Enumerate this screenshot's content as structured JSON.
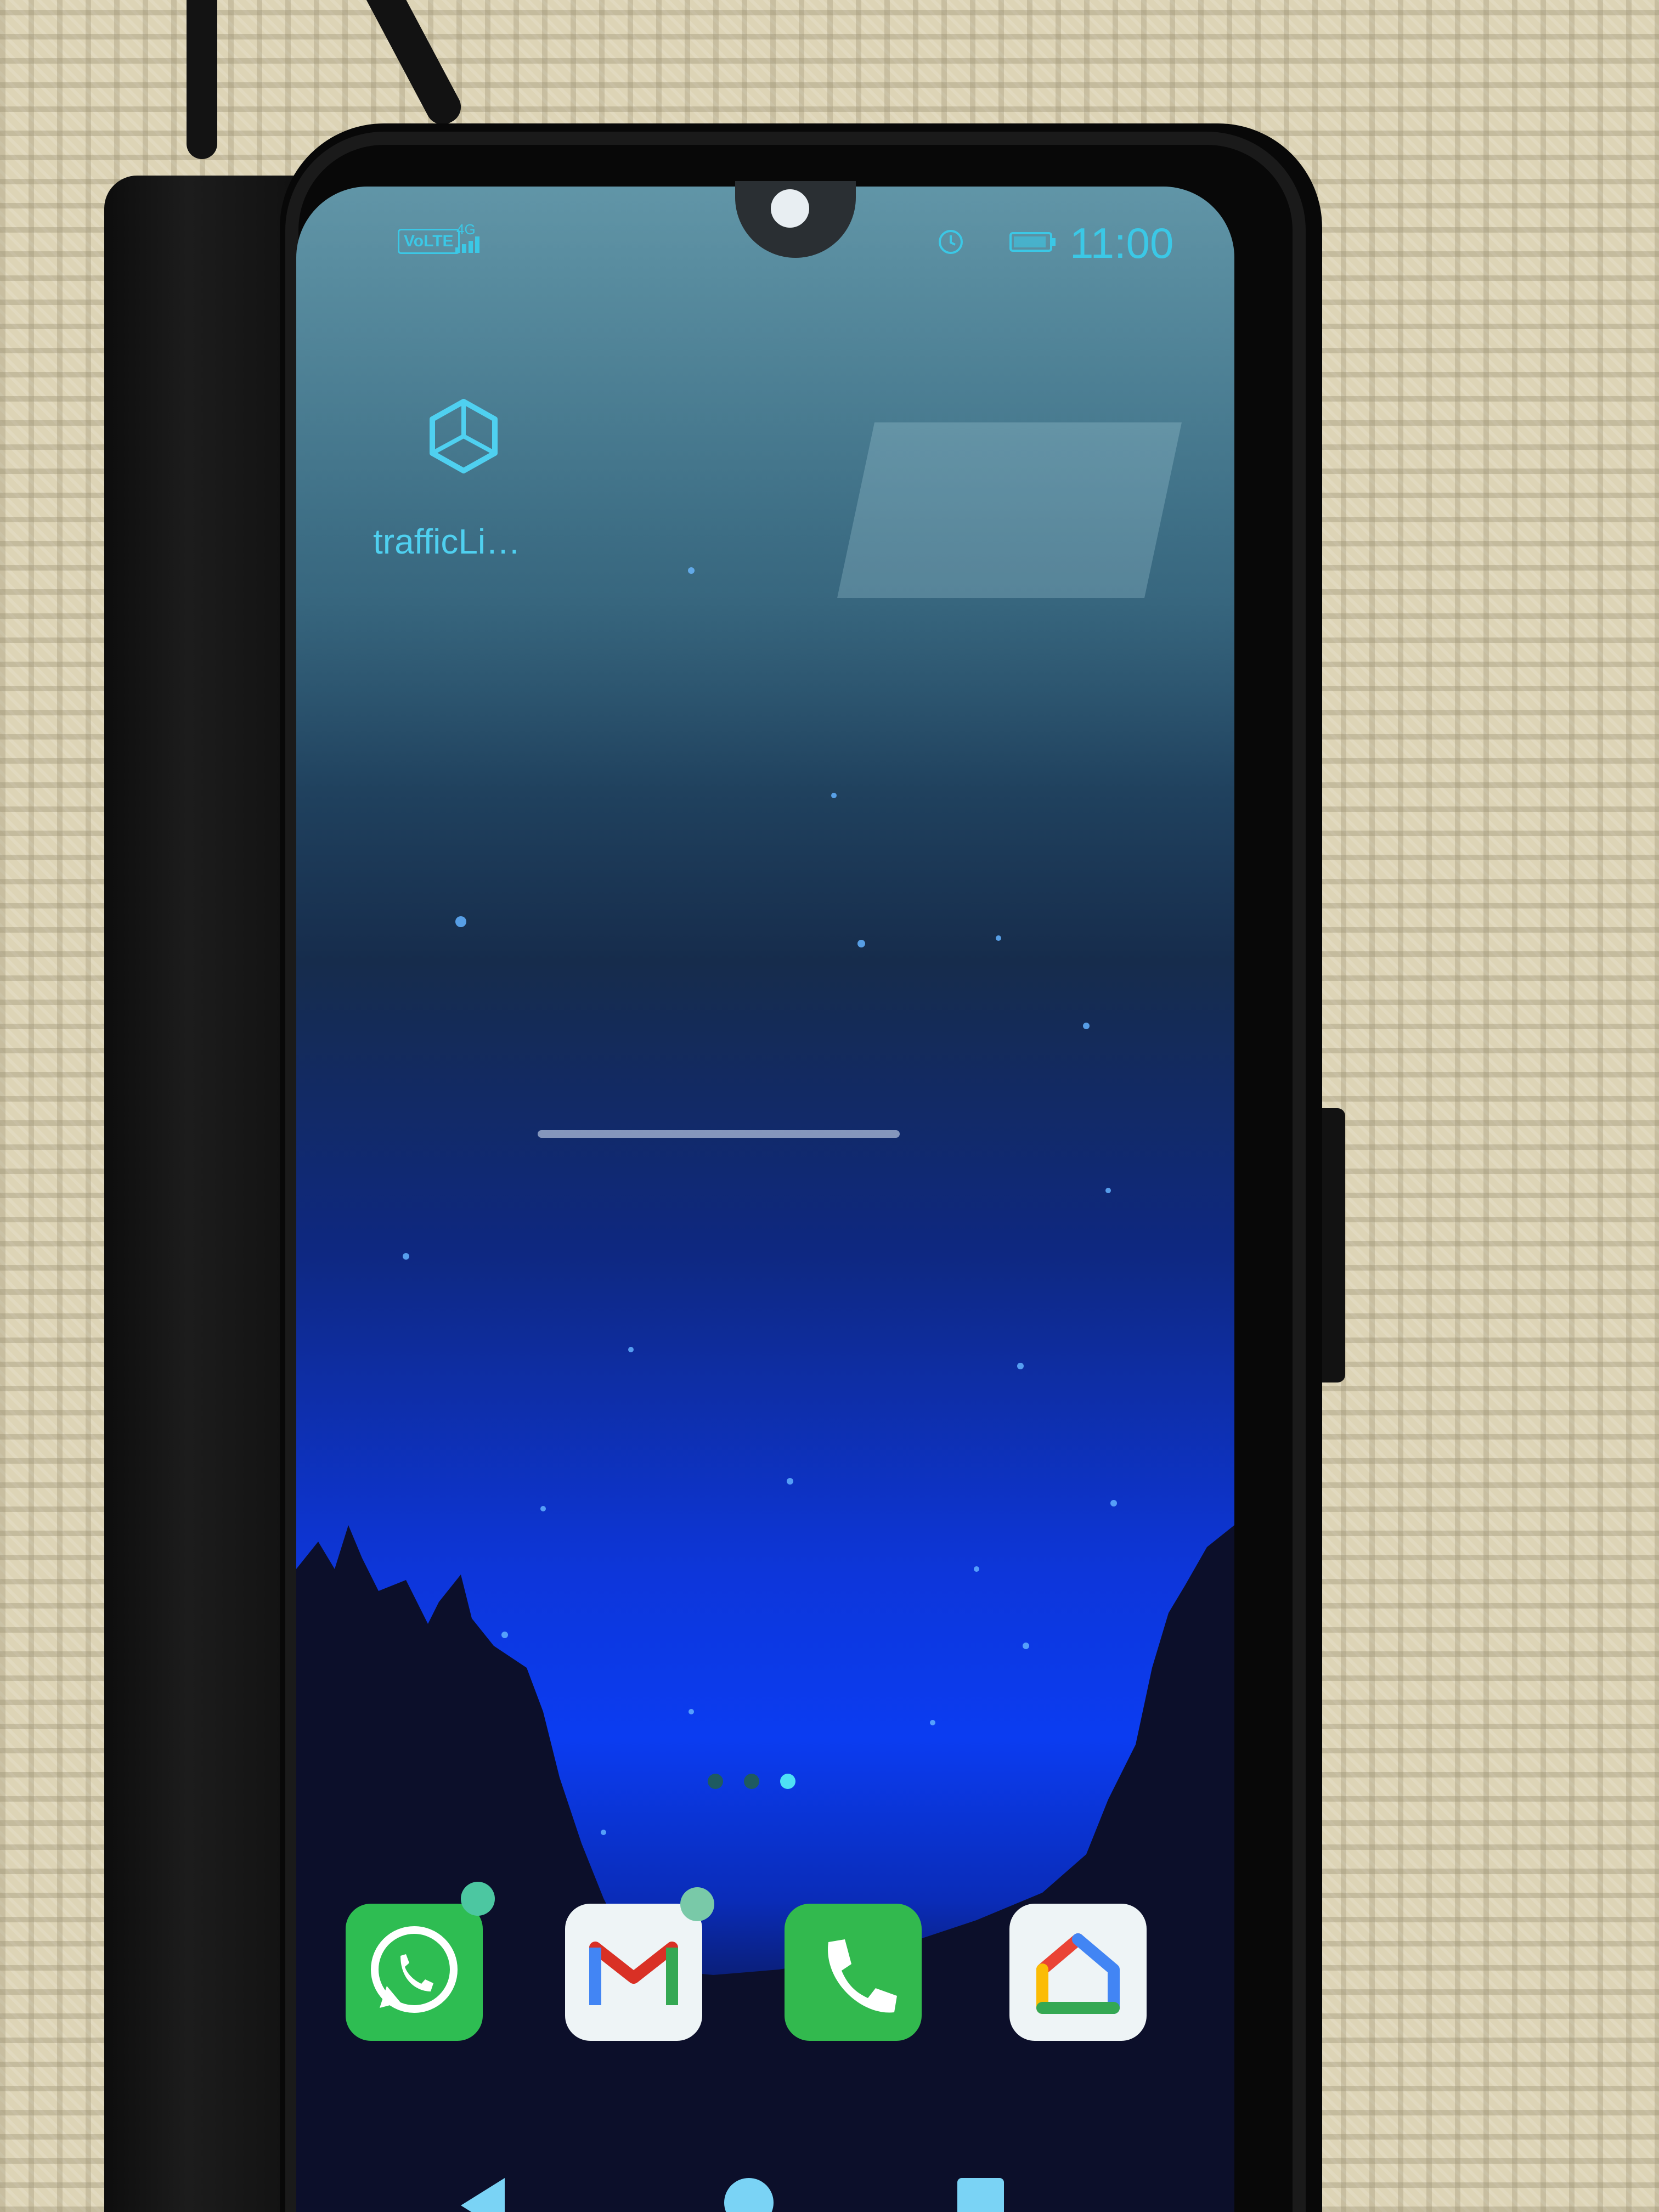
{
  "status_bar": {
    "carrier_badge": "VoLTE",
    "network_type": "4G",
    "time": "11:00"
  },
  "home_screen": {
    "apps": [
      {
        "label": "trafficLi…",
        "icon": "unity-icon"
      }
    ],
    "page_indicator": {
      "pages": 3,
      "current_page": 3
    },
    "dock": [
      {
        "name": "WhatsApp",
        "icon": "whatsapp-icon",
        "color": "#25d366",
        "has_notification_dot": true
      },
      {
        "name": "Gmail",
        "icon": "gmail-icon",
        "color": "#ffffff",
        "has_notification_dot": true
      },
      {
        "name": "Phone",
        "icon": "phone-icon",
        "color": "#2dbb4a",
        "has_notification_dot": false
      },
      {
        "name": "Google Home",
        "icon": "google-home-icon",
        "color": "#ffffff",
        "has_notification_dot": false
      }
    ]
  },
  "navigation_bar": {
    "buttons": [
      "back-icon",
      "home-icon",
      "recents-icon"
    ]
  },
  "colors": {
    "accent_text": "#4fd0f0",
    "wallpaper_blue": "#0b3cf1",
    "notification_dot": "#4cc7a1"
  }
}
